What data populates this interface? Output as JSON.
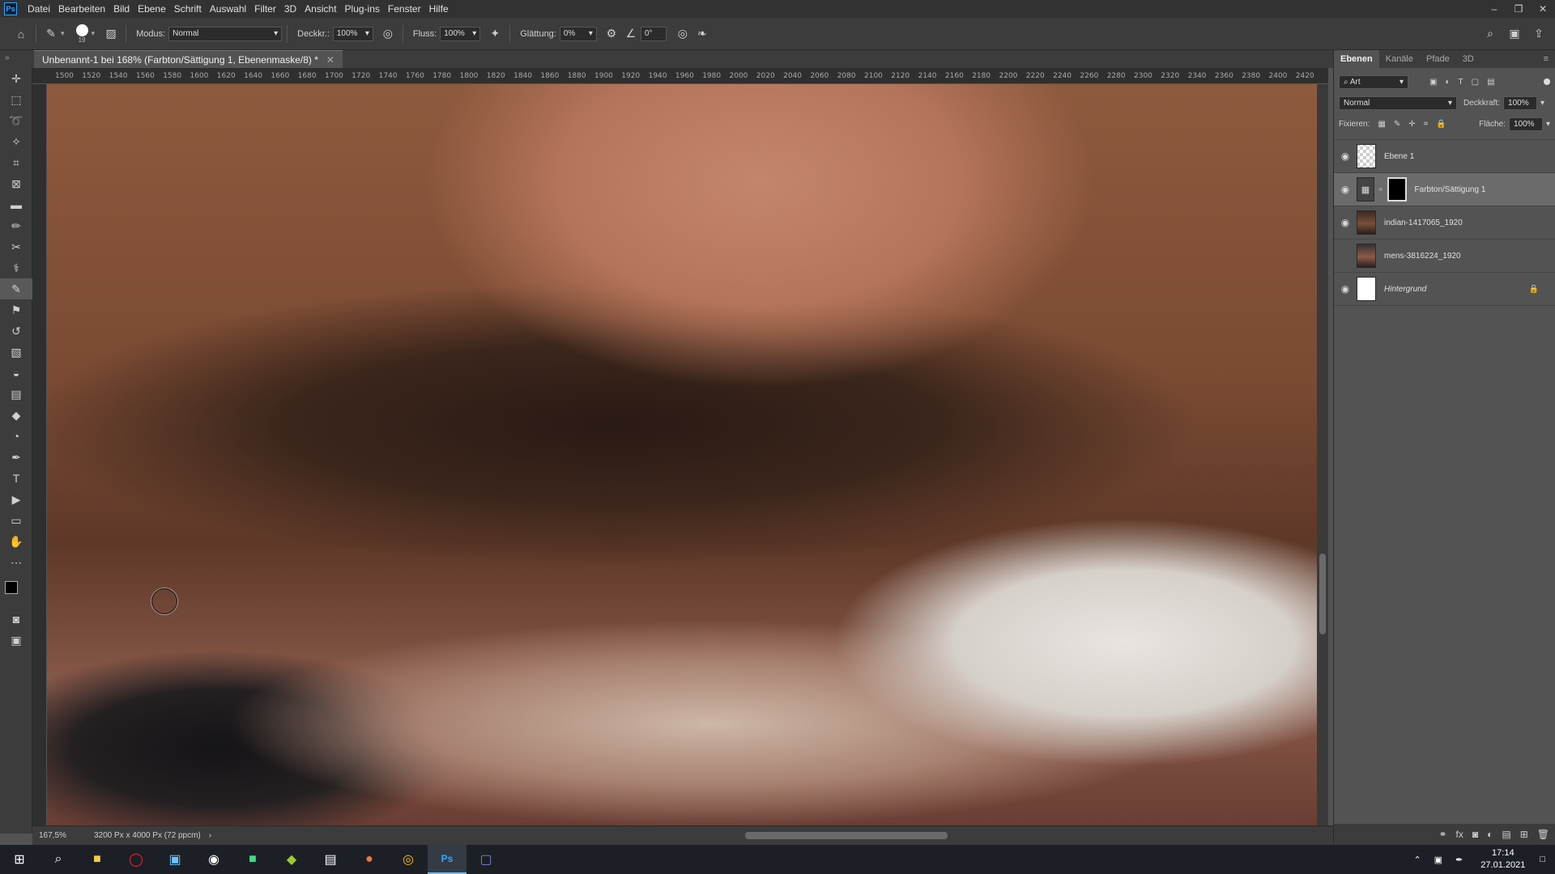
{
  "menubar": {
    "app_icon": "Ps",
    "items": [
      "Datei",
      "Bearbeiten",
      "Bild",
      "Ebene",
      "Schrift",
      "Auswahl",
      "Filter",
      "3D",
      "Ansicht",
      "Plug-ins",
      "Fenster",
      "Hilfe"
    ]
  },
  "optbar": {
    "brush_size": "19",
    "modus_label": "Modus:",
    "modus_value": "Normal",
    "deckkr_label": "Deckkr.:",
    "deckkr_value": "100%",
    "fluss_label": "Fluss:",
    "fluss_value": "100%",
    "glaettung_label": "Glättung:",
    "glaettung_value": "0%",
    "angle_value": "0°"
  },
  "document": {
    "tab_title": "Unbenannt-1 bei 168% (Farbton/Sättigung 1, Ebenenmaske/8) *",
    "zoom": "167,5%",
    "doc_info": "3200 Px x 4000 Px (72 ppcm)"
  },
  "ruler": {
    "ticks": [
      "1500",
      "1520",
      "1540",
      "1560",
      "1580",
      "1600",
      "1620",
      "1640",
      "1660",
      "1680",
      "1700",
      "1720",
      "1740",
      "1760",
      "1780",
      "1800",
      "1820",
      "1840",
      "1860",
      "1880",
      "1900",
      "1920",
      "1940",
      "1960",
      "1980",
      "2000",
      "2020",
      "2040",
      "2060",
      "2080",
      "2100",
      "2120",
      "2140",
      "2160",
      "2180",
      "2200",
      "2220",
      "2240",
      "2260",
      "2280",
      "2300",
      "2320",
      "2340",
      "2360",
      "2380",
      "2400",
      "2420"
    ]
  },
  "panel": {
    "tabs": [
      "Ebenen",
      "Kanäle",
      "Pfade",
      "3D"
    ],
    "filter_value": "Art",
    "blend_mode": "Normal",
    "deckkraft_label": "Deckkraft:",
    "deckkraft_value": "100%",
    "fixieren_label": "Fixieren:",
    "flaeche_label": "Fläche:",
    "flaeche_value": "100%",
    "layers": [
      {
        "name": "Ebene 1",
        "visible": true
      },
      {
        "name": "Farbton/Sättigung 1",
        "visible": true
      },
      {
        "name": "indian-1417065_1920",
        "visible": true
      },
      {
        "name": "mens-3816224_1920",
        "visible": false
      },
      {
        "name": "Hintergrund",
        "visible": true
      }
    ]
  },
  "taskbar": {
    "time": "17:14",
    "date": "27.01.2021"
  },
  "colors": {
    "foreground": "#000000",
    "background": "#ffffff",
    "accent": "#31a8ff"
  }
}
